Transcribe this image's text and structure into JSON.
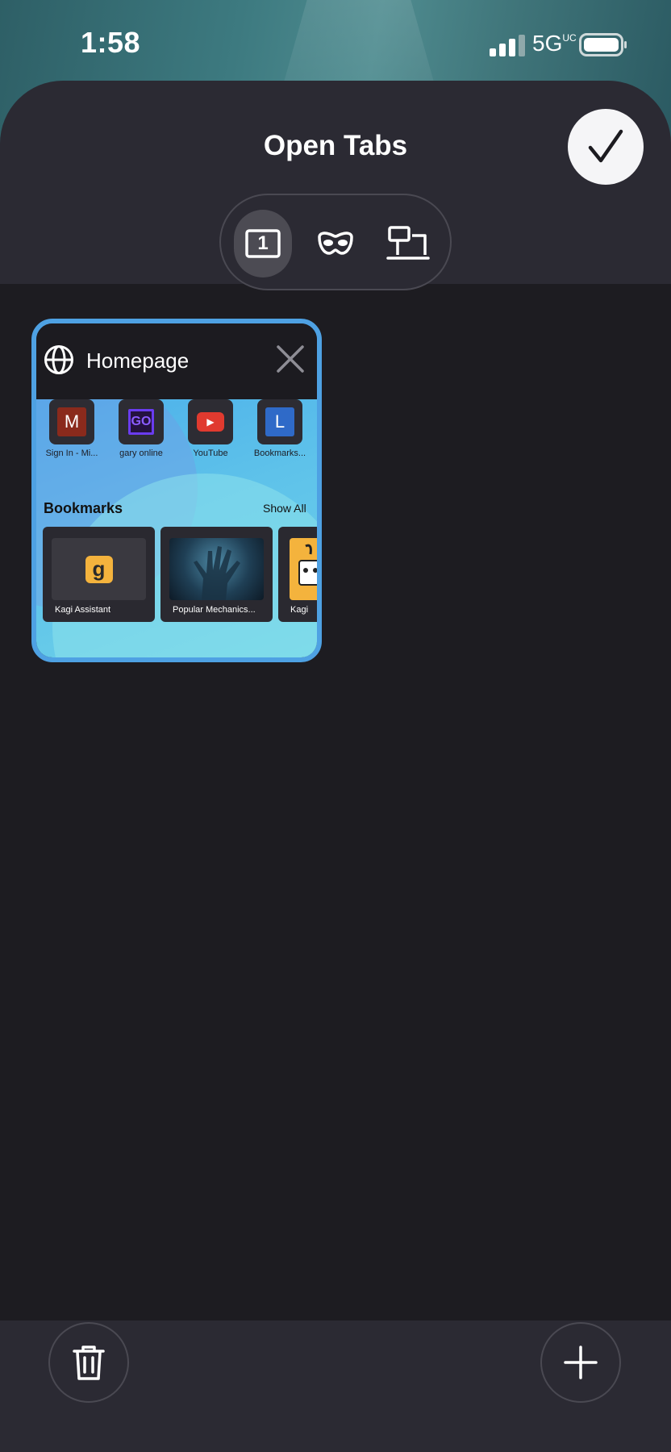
{
  "status_bar": {
    "time": "1:58",
    "network": "5G",
    "network_suffix": "UC",
    "signal_icon": "cellular-signal-icon",
    "battery_icon": "battery-icon"
  },
  "header": {
    "title": "Open Tabs",
    "done_icon": "checkmark-icon"
  },
  "tab_switcher": {
    "segments": [
      {
        "icon": "tab-count-icon",
        "count": "1",
        "selected": true
      },
      {
        "icon": "private-mask-icon",
        "selected": false
      },
      {
        "icon": "synced-devices-icon",
        "selected": false
      }
    ]
  },
  "tabs": [
    {
      "title": "Homepage",
      "icon": "globe-icon",
      "preview": {
        "favorites": [
          {
            "letter": "M",
            "label": "Sign In - Mi...",
            "color": "#8a2a1c"
          },
          {
            "letter": "GO",
            "label": "gary online",
            "color": "#5b2bd8"
          },
          {
            "letter": "▶",
            "label": "YouTube",
            "color": "#e03a2f"
          },
          {
            "letter": "L",
            "label": "Bookmarks...",
            "color": "#2f6ac8"
          }
        ],
        "bookmarks_heading": "Bookmarks",
        "show_all": "Show All",
        "bookmarks": [
          {
            "label": "Kagi Assistant",
            "icon": "kagi-icon"
          },
          {
            "label": "Popular Mechanics...",
            "icon": "hand-image"
          },
          {
            "label": "Kagi",
            "icon": "kagi-dog-icon"
          }
        ]
      }
    }
  ],
  "bottom_bar": {
    "delete_icon": "trash-icon",
    "new_tab_icon": "plus-icon"
  },
  "colors": {
    "accent": "#4ea1e3",
    "background": "#1d1c21",
    "sheet": "#2b2a33"
  }
}
